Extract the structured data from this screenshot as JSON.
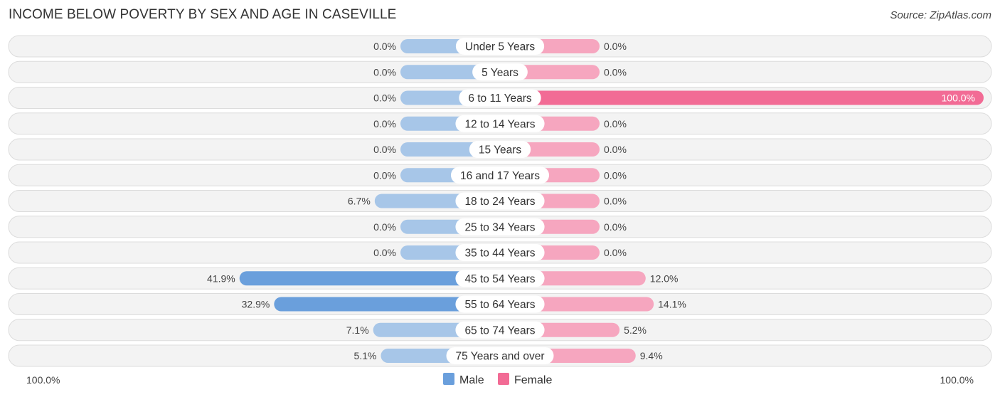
{
  "header": {
    "title": "INCOME BELOW POVERTY BY SEX AND AGE IN CASEVILLE",
    "source": "Source: ZipAtlas.com"
  },
  "colors": {
    "male_strong": "#6a9fdc",
    "male_light": "#a7c6e8",
    "female_strong": "#f26b95",
    "female_light": "#f6a6bf"
  },
  "chart_data": {
    "type": "bar",
    "orientation": "horizontal-diverging",
    "title": "INCOME BELOW POVERTY BY SEX AND AGE IN CASEVILLE",
    "categories": [
      "Under 5 Years",
      "5 Years",
      "6 to 11 Years",
      "12 to 14 Years",
      "15 Years",
      "16 and 17 Years",
      "18 to 24 Years",
      "25 to 34 Years",
      "35 to 44 Years",
      "45 to 54 Years",
      "55 to 64 Years",
      "65 to 74 Years",
      "75 Years and over"
    ],
    "series": [
      {
        "name": "Male",
        "values": [
          0.0,
          0.0,
          0.0,
          0.0,
          0.0,
          0.0,
          6.7,
          0.0,
          0.0,
          41.9,
          32.9,
          7.1,
          5.1
        ]
      },
      {
        "name": "Female",
        "values": [
          0.0,
          0.0,
          100.0,
          0.0,
          0.0,
          0.0,
          0.0,
          0.0,
          0.0,
          12.0,
          14.1,
          5.2,
          9.4
        ]
      }
    ],
    "value_labels": {
      "male": [
        "0.0%",
        "0.0%",
        "0.0%",
        "0.0%",
        "0.0%",
        "0.0%",
        "6.7%",
        "0.0%",
        "0.0%",
        "41.9%",
        "32.9%",
        "7.1%",
        "5.1%"
      ],
      "female": [
        "0.0%",
        "0.0%",
        "100.0%",
        "0.0%",
        "0.0%",
        "0.0%",
        "0.0%",
        "0.0%",
        "0.0%",
        "12.0%",
        "14.1%",
        "5.2%",
        "9.4%"
      ]
    },
    "xlim": [
      -100,
      100
    ],
    "axis_labels": {
      "left": "100.0%",
      "right": "100.0%"
    },
    "legend": {
      "entries": [
        "Male",
        "Female"
      ],
      "position": "bottom-center"
    },
    "grid": false
  }
}
